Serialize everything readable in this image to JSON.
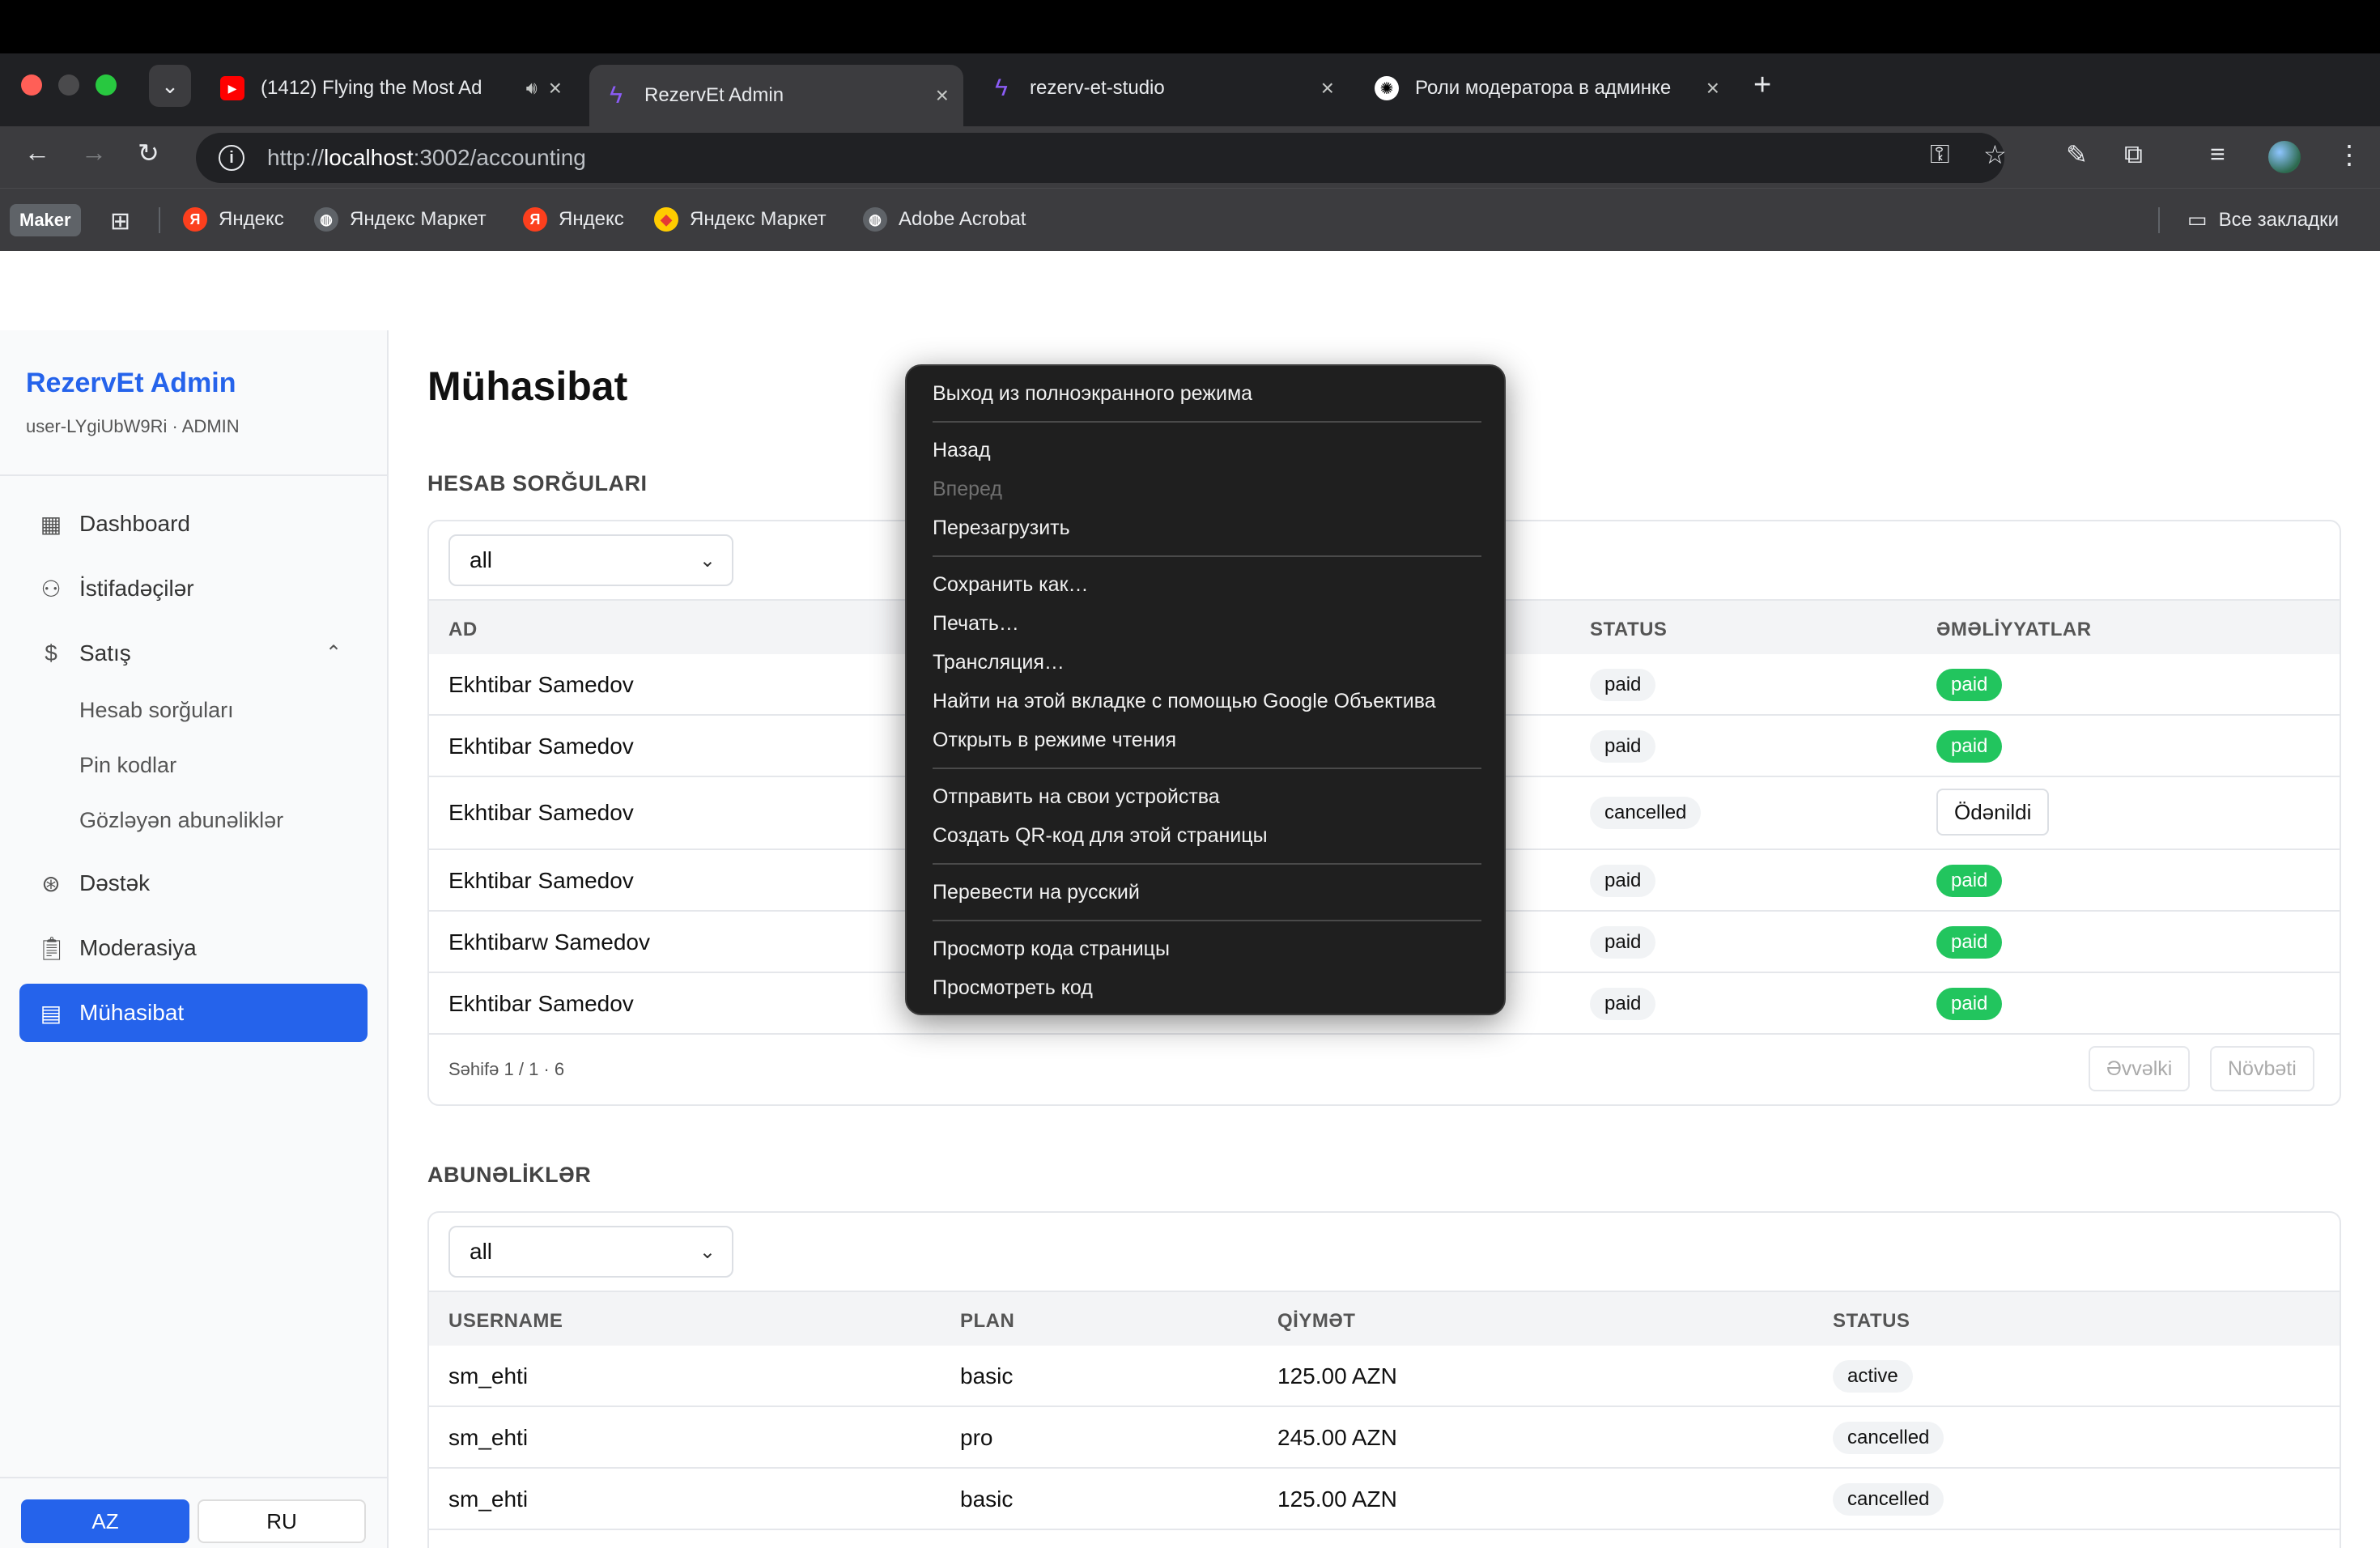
{
  "browser": {
    "tabs": [
      {
        "title": "(1412) Flying the Most Ad",
        "favicon": "youtube-icon"
      },
      {
        "title": "RezervEt Admin",
        "favicon": "bolt-icon"
      },
      {
        "title": "rezerv-et-studio",
        "favicon": "bolt-icon"
      },
      {
        "title": "Роли модератора в админке",
        "favicon": "chatgpt-icon"
      }
    ],
    "url_prefix": "http://",
    "url_host": "localhost",
    "url_path": ":3002/accounting",
    "bookmarks": {
      "maker": "Maker",
      "items": [
        "Яндекс",
        "Яндекс Маркет",
        "Яндекс",
        "Яндекс Маркет",
        "Adobe Acrobat"
      ],
      "all_bookmarks": "Все закладки"
    }
  },
  "sidebar": {
    "brand": "RezervEt Admin",
    "user": "user-LYgiUbW9Ri · ADMIN",
    "nav": [
      {
        "label": "Dashboard",
        "icon": "grid-icon"
      },
      {
        "label": "İstifadəçilər",
        "icon": "users-icon"
      },
      {
        "label": "Satış",
        "icon": "dollar-icon"
      },
      {
        "label": "Dəstək",
        "icon": "lifebuoy-icon"
      },
      {
        "label": "Moderasiya",
        "icon": "clipboard-icon"
      },
      {
        "label": "Mühasibat",
        "icon": "calculator-icon"
      }
    ],
    "sub_nav": [
      "Hesab sorğuları",
      "Pin kodlar",
      "Gözləyən abunəliklər"
    ],
    "languages": [
      "AZ",
      "RU"
    ]
  },
  "main": {
    "title": "Mühasibat",
    "invoices": {
      "heading": "HESAB SORĞULARI",
      "filter": "all",
      "columns": {
        "name": "AD",
        "status": "STATUS",
        "actions": "ƏMƏLİYYATLAR"
      },
      "rows": [
        {
          "name": "Ekhtibar Samedov",
          "status": "paid",
          "action": "paid"
        },
        {
          "name": "Ekhtibar Samedov",
          "status": "paid",
          "action": "paid"
        },
        {
          "name": "Ekhtibar Samedov",
          "status": "cancelled",
          "action": "Ödənildi"
        },
        {
          "name": "Ekhtibar Samedov",
          "status": "paid",
          "action": "paid"
        },
        {
          "name": "Ekhtibarw Samedov",
          "status": "paid",
          "action": "paid"
        },
        {
          "name": "Ekhtibar Samedov",
          "status": "paid",
          "action": "paid"
        }
      ],
      "page_info": "Səhifə 1 / 1 · 6",
      "prev": "Əvvəlki",
      "next": "Növbəti"
    },
    "subscriptions": {
      "heading": "ABUNƏLİKLƏR",
      "filter": "all",
      "columns": {
        "username": "USERNAME",
        "plan": "PLAN",
        "price": "QİYMƏT",
        "status": "STATUS"
      },
      "rows": [
        {
          "username": "sm_ehti",
          "plan": "basic",
          "price": "125.00 AZN",
          "status": "active"
        },
        {
          "username": "sm_ehti",
          "plan": "pro",
          "price": "245.00 AZN",
          "status": "cancelled"
        },
        {
          "username": "sm_ehti",
          "plan": "basic",
          "price": "125.00 AZN",
          "status": "cancelled"
        }
      ]
    }
  },
  "context_menu": {
    "items": [
      "Выход из полноэкранного режима",
      "Назад",
      "Вперед",
      "Перезагрузить",
      "Сохранить как…",
      "Печать…",
      "Трансляция…",
      "Найти на этой вкладке с помощью Google Объектива",
      "Открыть в режиме чтения",
      "Отправить на свои устройства",
      "Создать QR-код для этой страницы",
      "Перевести на русский",
      "Просмотр кода страницы",
      "Просмотреть код"
    ]
  },
  "colors": {
    "accent": "#2563eb",
    "paid_green": "#22c55e"
  }
}
